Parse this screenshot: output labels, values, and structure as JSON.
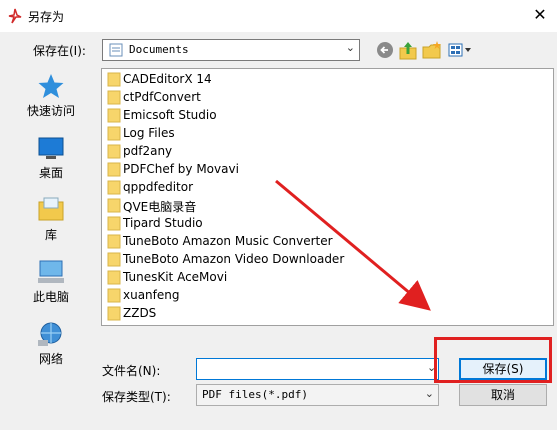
{
  "window": {
    "title": "另存为",
    "close_glyph": "✕"
  },
  "location": {
    "label": "保存在(I):",
    "value": "Documents"
  },
  "toolbar": {
    "back_icon": "back-arrow-icon",
    "up_icon": "up-folder-icon",
    "new_folder_icon": "new-folder-icon",
    "view_icon": "view-menu-icon"
  },
  "places": [
    {
      "label": "快速访问",
      "icon": "star-icon"
    },
    {
      "label": "桌面",
      "icon": "desktop-icon"
    },
    {
      "label": "库",
      "icon": "library-icon"
    },
    {
      "label": "此电脑",
      "icon": "computer-icon"
    },
    {
      "label": "网络",
      "icon": "network-icon"
    }
  ],
  "files": [
    "CADEditorX 14",
    "ctPdfConvert",
    "Emicsoft Studio",
    "Log Files",
    "pdf2any",
    "PDFChef by Movavi",
    "qppdfeditor",
    "QVE电脑录音",
    "Tipard Studio",
    "TuneBoto Amazon Music Converter",
    "TuneBoto Amazon Video Downloader",
    "TunesKit AceMovi",
    "xuanfeng",
    "ZZDS"
  ],
  "filename": {
    "label": "文件名(N):",
    "value": ""
  },
  "filetype": {
    "label": "保存类型(T):",
    "value": "PDF files(*.pdf)"
  },
  "buttons": {
    "save": "保存(S)",
    "cancel": "取消"
  },
  "colors": {
    "annotation": "#e02020",
    "folder": "#f7d56b",
    "accent": "#0078d7"
  }
}
